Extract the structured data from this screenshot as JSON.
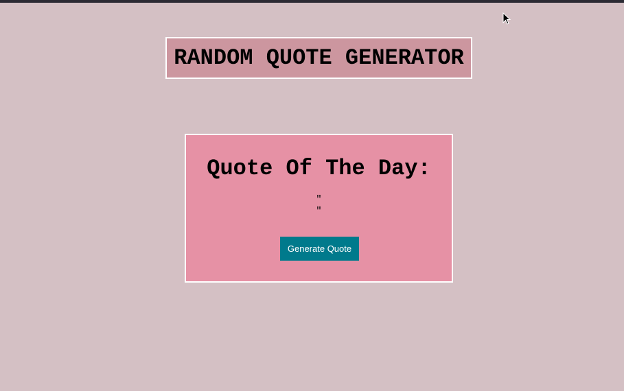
{
  "header": {
    "title": "RANDOM QUOTE GENERATOR"
  },
  "quote_card": {
    "heading": "Quote Of The Day:",
    "open_quote": "\"",
    "quote_body": "",
    "close_quote": "\"",
    "button_label": "Generate Quote"
  },
  "colors": {
    "page_background": "#d4c0c4",
    "title_background": "#cc969f",
    "card_background": "#e691a5",
    "button_background": "#007a8c",
    "border": "#ffffff",
    "top_bar": "#2b2a33"
  },
  "icons": {
    "pointer": "mouse-pointer-icon"
  }
}
